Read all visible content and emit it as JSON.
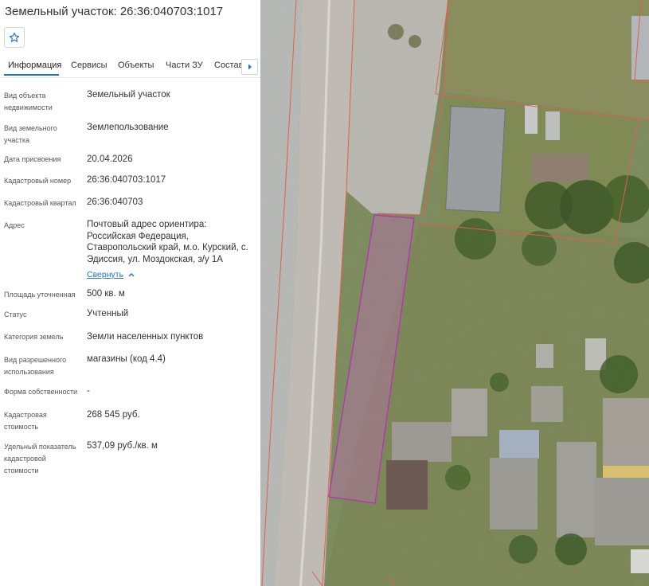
{
  "panel": {
    "title": "Земельный участок: 26:36:040703:1017",
    "favorite_icon": "star-outline-icon",
    "tabs": [
      {
        "label": "Информация",
        "active": true
      },
      {
        "label": "Сервисы",
        "active": false
      },
      {
        "label": "Объекты",
        "active": false
      },
      {
        "label": "Части ЗУ",
        "active": false
      },
      {
        "label": "Состав",
        "active": false
      }
    ],
    "tabs_next_icon": "chevron-right-icon",
    "fields": [
      {
        "label": "Вид объекта недвижимости",
        "value": "Земельный участок"
      },
      {
        "label": "Вид земельного участка",
        "value": "Землепользование"
      },
      {
        "label": "Дата присвоения",
        "value": "20.04.2026"
      },
      {
        "label": "Кадастровый номер",
        "value": "26:36:040703:1017"
      },
      {
        "label": "Кадастровый квартал",
        "value": "26:36:040703"
      },
      {
        "label": "Адрес",
        "value": "Почтовый адрес ориентира: Российская Федерация, Ставропольский край, м.о. Курский, с. Эдиссия, ул. Моздокская, з/у 1А"
      },
      {
        "label": "Площадь уточненная",
        "value": "500 кв. м"
      },
      {
        "label": "Статус",
        "value": "Учтенный"
      },
      {
        "label": "Категория земель",
        "value": "Земли населенных пунктов"
      },
      {
        "label": "Вид разрешенного использования",
        "value": "магазины (код 4.4)"
      },
      {
        "label": "Форма собственности",
        "value": "-"
      },
      {
        "label": "Кадастровая стоимость",
        "value": "268 545 руб."
      },
      {
        "label": "Удельный показатель кадастровой стоимости",
        "value": "537,09 руб./кв. м"
      }
    ],
    "collapse_link": "Свернуть"
  },
  "colors": {
    "accent": "#1e74c9",
    "parcel_outline": "#b03aa8",
    "parcel_fill": "#b86fb0",
    "cadastral_lines": "#e0604a"
  }
}
